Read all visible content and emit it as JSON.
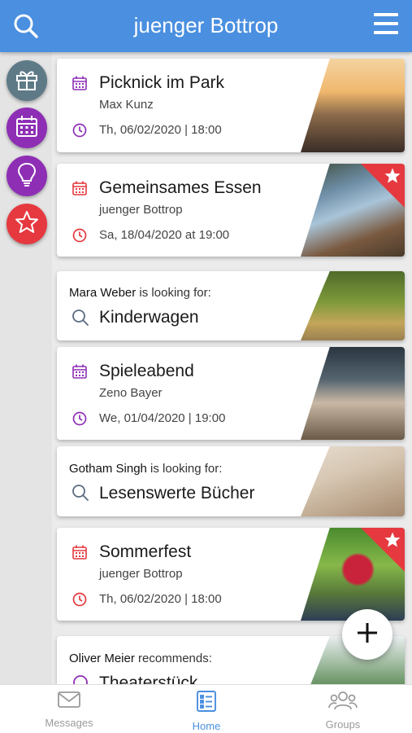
{
  "header": {
    "title": "juenger Bottrop",
    "search_icon": "search-icon",
    "menu_icon": "hamburger-menu-icon",
    "color": "#4a8fe0"
  },
  "sidebar": {
    "items": [
      {
        "name": "gift-icon",
        "color": "#5f7a87"
      },
      {
        "name": "calendar-icon",
        "color": "#8e2eb5"
      },
      {
        "name": "lightbulb-icon",
        "color": "#8e2eb5"
      },
      {
        "name": "star-icon",
        "color": "#e5393f"
      }
    ]
  },
  "cards": [
    {
      "type": "event",
      "title": "Picknick im Park",
      "subtitle": "Max Kunz",
      "date": "Th, 06/02/2020 | 18:00",
      "accent": "#8e2eb5",
      "favorite": false
    },
    {
      "type": "event",
      "title": "Gemeinsames Essen",
      "subtitle": "juenger Bottrop",
      "date": "Sa, 18/04/2020 at 19:00",
      "accent": "#e5393f",
      "favorite": true
    },
    {
      "type": "looking",
      "person": "Mara Weber",
      "suffix": " is looking for:",
      "title": "Kinderwagen"
    },
    {
      "type": "event",
      "title": "Spieleabend",
      "subtitle": "Zeno Bayer",
      "date": "We, 01/04/2020 | 19:00",
      "accent": "#8e2eb5",
      "favorite": false
    },
    {
      "type": "looking",
      "person": "Gotham Singh",
      "suffix": " is looking for:",
      "title": "Lesenswerte Bücher"
    },
    {
      "type": "event",
      "title": "Sommerfest",
      "subtitle": "juenger Bottrop",
      "date": "Th, 06/02/2020 | 18:00",
      "accent": "#e5393f",
      "favorite": true
    },
    {
      "type": "recommends",
      "person": "Oliver Meier",
      "suffix": " recommends:",
      "title": "Theaterstück"
    }
  ],
  "fab": {
    "icon": "plus-icon"
  },
  "nav": {
    "tabs": [
      {
        "label": "Messages",
        "icon": "envelope-icon",
        "active": false
      },
      {
        "label": "Home",
        "icon": "list-icon",
        "active": true
      },
      {
        "label": "Groups",
        "icon": "people-icon",
        "active": false
      }
    ],
    "active_color": "#4a8fe0"
  }
}
